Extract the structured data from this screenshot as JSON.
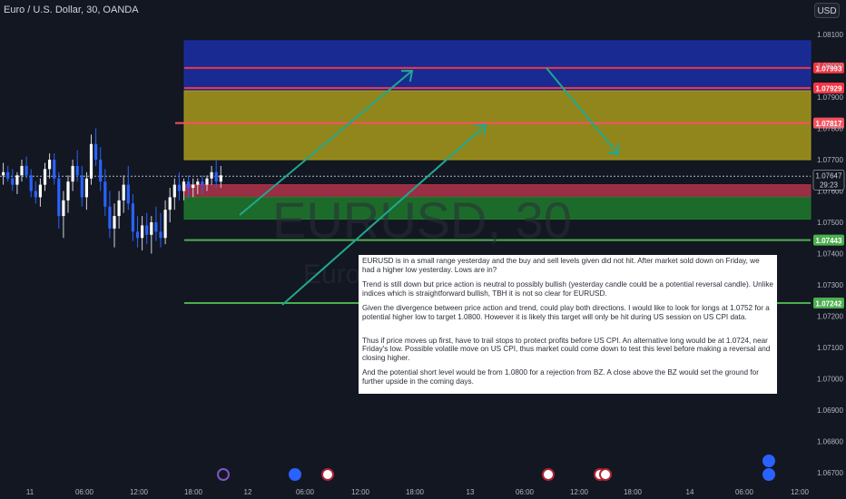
{
  "header": {
    "symbol_title": "Euro / U.S. Dollar, 30, OANDA",
    "currency": "USD"
  },
  "watermark": {
    "symbol": "EURUSD, 30",
    "description": "Euro"
  },
  "chart_data": {
    "type": "candlestick",
    "symbol": "EURUSD",
    "interval": "30",
    "ylim": [
      1.0665,
      1.0818
    ],
    "y_ticks": [
      "1.08100",
      "1.08000",
      "1.07900",
      "1.07800",
      "1.07700",
      "1.07600",
      "1.07500",
      "1.07400",
      "1.07300",
      "1.07200",
      "1.07100",
      "1.07000",
      "1.06900",
      "1.06800",
      "1.06700"
    ],
    "x_ticks": [
      "11",
      "06:00",
      "12:00",
      "18:00",
      "12",
      "06:00",
      "12:00",
      "18:00",
      "13",
      "06:00",
      "12:00",
      "18:00",
      "14",
      "06:00",
      "12:00"
    ],
    "last_price": "1.07647",
    "countdown": "29:23",
    "candles": [
      [
        1.0765,
        1.0769,
        1.0762,
        1.0766
      ],
      [
        1.0766,
        1.0768,
        1.0763,
        1.0764
      ],
      [
        1.0764,
        1.0767,
        1.076,
        1.0762
      ],
      [
        1.0762,
        1.0766,
        1.0759,
        1.0765
      ],
      [
        1.0765,
        1.077,
        1.0763,
        1.0768
      ],
      [
        1.0768,
        1.0771,
        1.0764,
        1.0765
      ],
      [
        1.0765,
        1.0767,
        1.0758,
        1.076
      ],
      [
        1.076,
        1.0763,
        1.0756,
        1.0758
      ],
      [
        1.0758,
        1.0764,
        1.0755,
        1.0762
      ],
      [
        1.0762,
        1.0769,
        1.076,
        1.0767
      ],
      [
        1.0767,
        1.0772,
        1.0764,
        1.077
      ],
      [
        1.077,
        1.0772,
        1.0762,
        1.0764
      ],
      [
        1.0764,
        1.0766,
        1.0748,
        1.0752
      ],
      [
        1.0752,
        1.076,
        1.0745,
        1.0757
      ],
      [
        1.0757,
        1.0765,
        1.0753,
        1.0763
      ],
      [
        1.0763,
        1.077,
        1.076,
        1.0768
      ],
      [
        1.0768,
        1.0773,
        1.0763,
        1.0765
      ],
      [
        1.0765,
        1.0768,
        1.0755,
        1.0758
      ],
      [
        1.0758,
        1.0766,
        1.0754,
        1.0764
      ],
      [
        1.0764,
        1.0778,
        1.0762,
        1.0775
      ],
      [
        1.0775,
        1.078,
        1.0768,
        1.077
      ],
      [
        1.077,
        1.0774,
        1.076,
        1.0763
      ],
      [
        1.0763,
        1.0767,
        1.0752,
        1.0755
      ],
      [
        1.0755,
        1.076,
        1.0745,
        1.0748
      ],
      [
        1.0748,
        1.0756,
        1.0742,
        1.0752
      ],
      [
        1.0752,
        1.076,
        1.0748,
        1.0757
      ],
      [
        1.0757,
        1.0765,
        1.0753,
        1.0762
      ],
      [
        1.0762,
        1.0768,
        1.0754,
        1.0756
      ],
      [
        1.0756,
        1.0759,
        1.0744,
        1.0747
      ],
      [
        1.0747,
        1.0752,
        1.0742,
        1.0745
      ],
      [
        1.0745,
        1.0752,
        1.0741,
        1.0749
      ],
      [
        1.0749,
        1.0753,
        1.0743,
        1.0746
      ],
      [
        1.0746,
        1.0752,
        1.074,
        1.075
      ],
      [
        1.075,
        1.0755,
        1.0744,
        1.0747
      ],
      [
        1.0747,
        1.0753,
        1.0742,
        1.0745
      ],
      [
        1.0745,
        1.0757,
        1.0743,
        1.0754
      ],
      [
        1.0754,
        1.0761,
        1.075,
        1.0758
      ],
      [
        1.0758,
        1.0764,
        1.0754,
        1.0762
      ],
      [
        1.0762,
        1.0766,
        1.0757,
        1.076
      ],
      [
        1.076,
        1.0764,
        1.0757,
        1.0763
      ],
      [
        1.0763,
        1.0765,
        1.0758,
        1.0761
      ],
      [
        1.0761,
        1.0764,
        1.0758,
        1.0762
      ],
      [
        1.0762,
        1.0764,
        1.0759,
        1.0763
      ],
      [
        1.0763,
        1.0765,
        1.0759,
        1.0762
      ],
      [
        1.0762,
        1.0765,
        1.076,
        1.0764
      ],
      [
        1.0764,
        1.0768,
        1.0762,
        1.0766
      ],
      [
        1.0766,
        1.077,
        1.0761,
        1.0763
      ],
      [
        1.0763,
        1.0768,
        1.0761,
        1.0765
      ]
    ],
    "zones": [
      {
        "kind": "supply-zone",
        "top": 1.0808,
        "bottom": 1.0792,
        "color": "#1b2fa6"
      },
      {
        "kind": "buy-zone",
        "top": 1.0792,
        "bottom": 1.077,
        "color": "#a89a1a"
      },
      {
        "kind": "sell-strip",
        "top": 1.0762,
        "bottom": 1.0758,
        "color": "#b2334a"
      },
      {
        "kind": "demand-zone",
        "top": 1.0758,
        "bottom": 1.0751,
        "color": "#1e7a2c"
      }
    ],
    "levels": [
      {
        "value": 1.07993,
        "label": "1.07993",
        "color": "#f23645"
      },
      {
        "value": 1.07929,
        "label": "1.07929",
        "color": "#f23645"
      },
      {
        "value": 1.07817,
        "label": "1.07817",
        "color": "#f7525f"
      },
      {
        "value": 1.07443,
        "label": "1.07443",
        "color": "#4caf50"
      },
      {
        "value": 1.07242,
        "label": "1.07242",
        "color": "#4caf50"
      }
    ],
    "arrows_color": "#1fa88f",
    "event_markers": [
      {
        "kind": "lightning",
        "color": "#7e57c2"
      },
      {
        "kind": "earnings",
        "color": "#2962ff"
      },
      {
        "kind": "us-flag",
        "color": "#b22234"
      },
      {
        "kind": "us-flag",
        "color": "#b22234"
      },
      {
        "kind": "us-flag",
        "color": "#b22234"
      },
      {
        "kind": "us-flag",
        "color": "#b22234"
      },
      {
        "kind": "earnings",
        "color": "#2962ff"
      }
    ]
  },
  "note": {
    "paragraphs": [
      "EURUSD is in a small range yesterday and the buy and sell levels given did not hit. After market sold down on Friday, we had a higher low yesterday. Lows are in?",
      "Trend is still down but price action is neutral to possibly bullish (yesterday candle could be a potential reversal candle). Unlike indices which is straightforward bullish, TBH it is not so clear for EURUSD.",
      "Given the divergence between price action and trend, could play both directions. I would like to look for longs at 1.0752 for a potential higher low to target 1.0800. However it is likely this target will only be hit during US session on US CPI data.",
      "Thus if price moves up first, have to trail stops to protect profits before US CPI. An alternative long would be at 1.0724, near Friday's low. Possible volatile move on US CPI, thus market could come down to test this level before making a reversal and closing higher.",
      "And the potential short level would be from 1.0800 for a rejection from BZ. A close above the BZ would set the ground for further upside in the coming days."
    ]
  }
}
